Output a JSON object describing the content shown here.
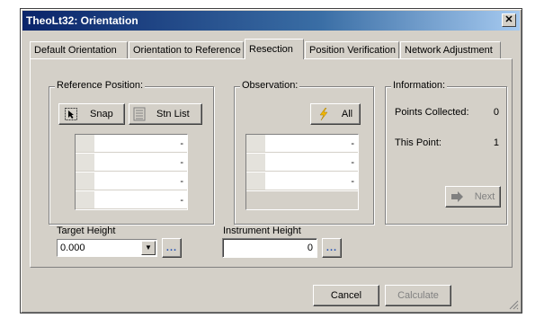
{
  "window": {
    "title": "TheoLt32: Orientation",
    "close_icon": "close-icon"
  },
  "tabs": [
    {
      "label": "Default Orientation",
      "active": false
    },
    {
      "label": "Orientation to Reference",
      "active": false
    },
    {
      "label": "Resection",
      "active": true
    },
    {
      "label": "Position Verification",
      "active": false
    },
    {
      "label": "Network Adjustment",
      "active": false
    }
  ],
  "reference_position": {
    "legend": "Reference Position:",
    "snap_label": "Snap",
    "snap_icon": "cursor-select-icon",
    "stn_list_label": "Stn List",
    "stn_list_icon": "list-icon",
    "rows": [
      "-",
      "-",
      "-",
      "-"
    ]
  },
  "observation": {
    "legend": "Observation:",
    "all_label": "All",
    "all_icon": "lightning-icon",
    "rows": [
      "-",
      "-",
      "-"
    ]
  },
  "information": {
    "legend": "Information:",
    "points_collected_label": "Points Collected:",
    "points_collected_value": "0",
    "this_point_label": "This Point:",
    "this_point_value": "1",
    "next_label": "Next",
    "next_icon": "arrow-right-icon"
  },
  "target_height": {
    "label": "Target Height",
    "value": "0.000",
    "browse_label": "..."
  },
  "instrument_height": {
    "label": "Instrument Height",
    "value": "0",
    "browse_label": "..."
  },
  "footer": {
    "cancel_label": "Cancel",
    "calculate_label": "Calculate"
  }
}
